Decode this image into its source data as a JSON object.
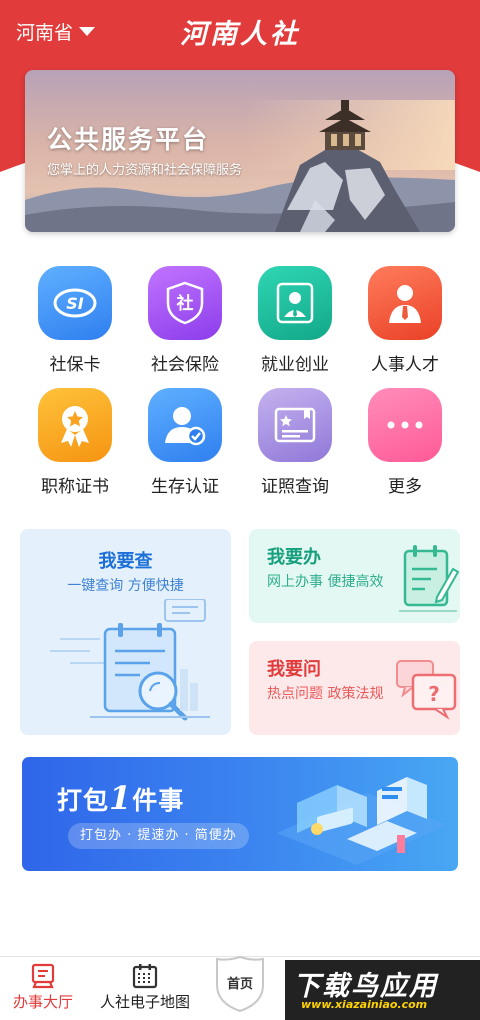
{
  "header": {
    "province": "河南省",
    "title": "河南人社",
    "accent_color": "#e23b3b"
  },
  "banner": {
    "title": "公共服务平台",
    "subtitle": "您掌上的人力资源和社会保障服务"
  },
  "services": [
    {
      "label": "社保卡",
      "icon": "social-security-card-icon",
      "color": "#3b8ff0"
    },
    {
      "label": "社会保险",
      "icon": "shield-badge-icon",
      "color": "#9b4ef0"
    },
    {
      "label": "就业创业",
      "icon": "worker-id-icon",
      "color": "#19b99a"
    },
    {
      "label": "人事人才",
      "icon": "person-tie-icon",
      "color": "#f05a3c"
    },
    {
      "label": "职称证书",
      "icon": "award-medal-icon",
      "color": "#fba21f"
    },
    {
      "label": "生存认证",
      "icon": "user-verified-icon",
      "color": "#3b8ff0"
    },
    {
      "label": "证照查询",
      "icon": "certificate-icon",
      "color": "#9b7ee8"
    },
    {
      "label": "更多",
      "icon": "more-dots-icon",
      "color": "#ff6fa6"
    }
  ],
  "cards": {
    "query": {
      "title": "我要查",
      "subtitle": "一键查询  方便快捷",
      "icon": "calendar-search-icon"
    },
    "handle": {
      "title": "我要办",
      "subtitle": "网上办事  便捷高效",
      "icon": "clipboard-pen-icon"
    },
    "ask": {
      "title": "我要问",
      "subtitle": "热点问题  政策法规",
      "icon": "question-chat-icon"
    }
  },
  "promo": {
    "title_before": "打包",
    "title_number": "1",
    "title_after": "件事",
    "tagline": "打包办 · 提速办 · 简便办"
  },
  "bottom_nav": {
    "hall": "办事大厅",
    "map": "人社电子地图",
    "home": "首页"
  },
  "watermark": {
    "big": "下载鸟应用",
    "small": "www.xiazainiao.com"
  }
}
